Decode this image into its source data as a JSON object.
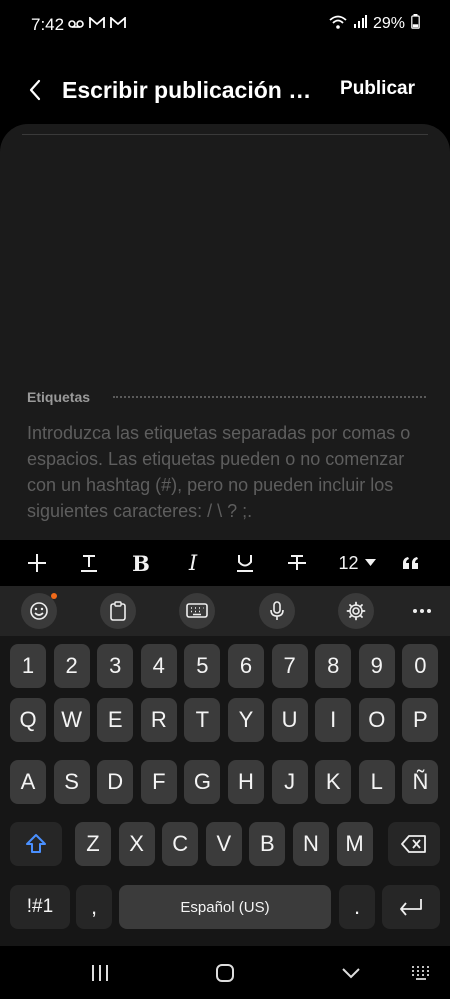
{
  "status_bar": {
    "time": "7:42",
    "notification_icons": [
      "voicemail-icon",
      "gmail-icon",
      "gmail-icon"
    ],
    "battery_percent": "29%",
    "battery_level": 0.29
  },
  "app_bar": {
    "title": "Escribir publicación p…",
    "publish_label": "Publicar"
  },
  "editor": {
    "tags_label": "Etiquetas",
    "tags_placeholder": "Introduzca las etiquetas separadas por comas o espacios. Las etiquetas pueden o no comenzar con un hashtag (#), pero no pueden incluir los siguientes caracteres: / \\ ? ;."
  },
  "format_bar": {
    "font_size": "12"
  },
  "keyboard": {
    "row_numbers": [
      "1",
      "2",
      "3",
      "4",
      "5",
      "6",
      "7",
      "8",
      "9",
      "0"
    ],
    "row_1": [
      "Q",
      "W",
      "E",
      "R",
      "T",
      "Y",
      "U",
      "I",
      "O",
      "P"
    ],
    "row_2": [
      "A",
      "S",
      "D",
      "F",
      "G",
      "H",
      "J",
      "K",
      "L",
      "Ñ"
    ],
    "row_3": [
      "Z",
      "X",
      "C",
      "V",
      "B",
      "N",
      "M"
    ],
    "symbols_label": "!#1",
    "comma_label": ",",
    "space_label": "Español (US)",
    "period_label": "."
  },
  "colors": {
    "background": "#000000",
    "editor_bg": "#1b1b1b",
    "key_bg": "#3b3b3b",
    "shift_accent": "#4a90ff",
    "emoji_badge": "#f06a1a"
  }
}
